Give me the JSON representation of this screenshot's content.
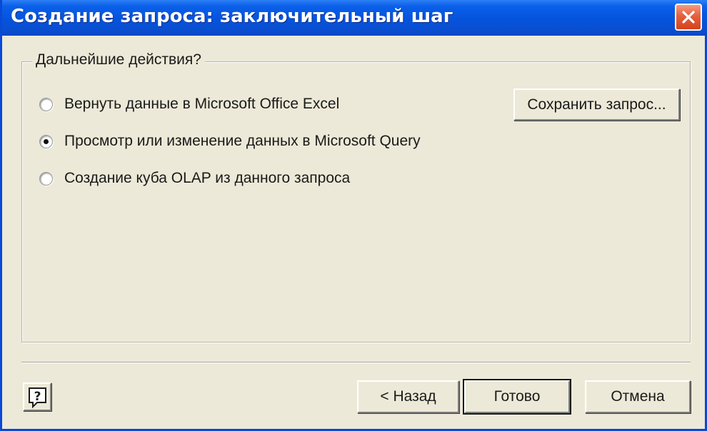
{
  "window": {
    "title": "Создание запроса: заключительный шаг",
    "close_icon": "close-x-icon"
  },
  "group": {
    "label": "Дальнейшие действия?",
    "options": [
      {
        "label": "Вернуть данные в Microsoft Office Excel",
        "checked": false
      },
      {
        "label": "Просмотр или изменение данных в Microsoft Query",
        "checked": true
      },
      {
        "label": "Создание куба OLAP из данного запроса",
        "checked": false
      }
    ],
    "save_query_label": "Сохранить запрос..."
  },
  "footer": {
    "help_icon": "help-question-icon",
    "back_label": "< Назад",
    "finish_label": "Готово",
    "cancel_label": "Отмена"
  },
  "colors": {
    "titlebar": "#0553dd",
    "close_button": "#e5603c",
    "dialog_background": "#ece9d8"
  }
}
